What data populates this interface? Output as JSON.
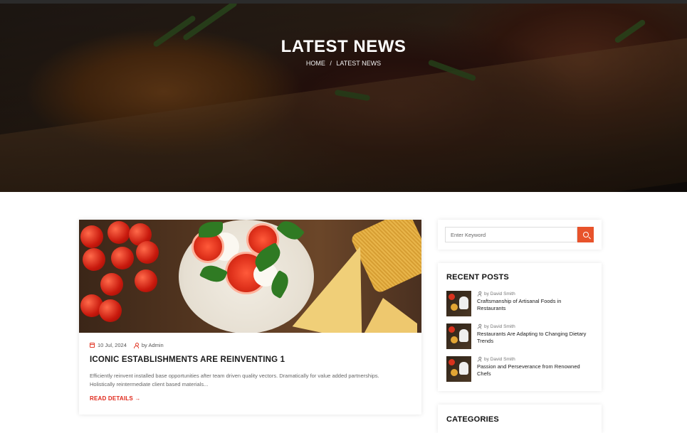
{
  "hero": {
    "title": "LATEST NEWS",
    "breadcrumb": {
      "home": "HOME",
      "separator": "/",
      "current": "LATEST NEWS"
    }
  },
  "post": {
    "date": "10 Jul, 2024",
    "author": "by Admin",
    "title": "ICONIC ESTABLISHMENTS ARE REINVENTING 1",
    "excerpt": "Efficiently reinvent installed base opportunities after team driven quality vectors. Dramatically for value added partnerships. Holistically reintermediate client based materials...",
    "read_more": "READ DETAILS →"
  },
  "sidebar": {
    "search": {
      "placeholder": "Enter Keyword",
      "button_icon": "search-icon"
    },
    "recent_posts": {
      "title": "RECENT POSTS",
      "items": [
        {
          "author": "by David Smith",
          "title": "Craftsmanship of Artisanal Foods in Restaurants"
        },
        {
          "author": "by David Smith",
          "title": "Restaurants Are Adapting to Changing Dietary Trends"
        },
        {
          "author": "by David Smith",
          "title": "Passion and Perseverance from Renowned Chefs"
        }
      ]
    },
    "categories": {
      "title": "CATEGORIES"
    }
  },
  "colors": {
    "accent": "#e8532b",
    "link_red": "#e0281b",
    "title": "#1b1b1b"
  }
}
